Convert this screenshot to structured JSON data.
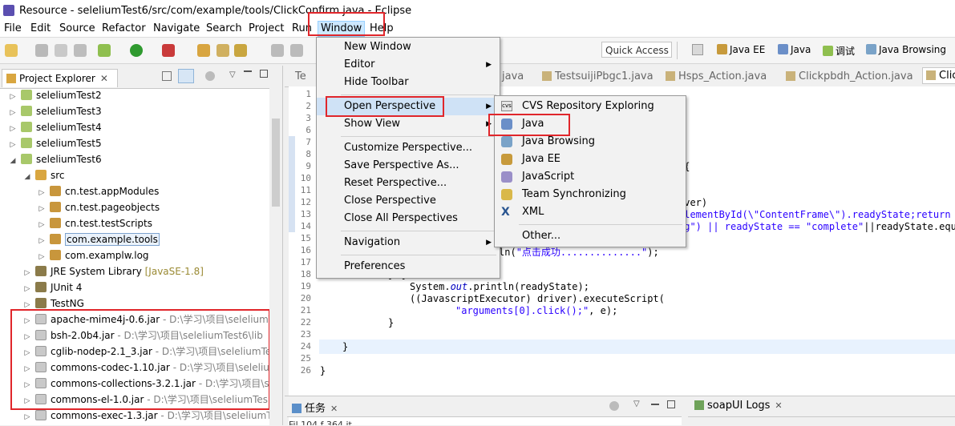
{
  "window": {
    "title": "Resource - seleliumTest6/src/com/example/tools/ClickConfirm.java - Eclipse"
  },
  "menubar": [
    "File",
    "Edit",
    "Source",
    "Refactor",
    "Navigate",
    "Search",
    "Project",
    "Run",
    "Window",
    "Help"
  ],
  "toolbar": {
    "quick_access_placeholder": "Quick Access",
    "perspectives": [
      "Java EE",
      "Java",
      "调试",
      "Java Browsing"
    ]
  },
  "explorer": {
    "tab_label": "Project Explorer",
    "items": [
      {
        "label": "seleliumTest2",
        "path": ""
      },
      {
        "label": "seleliumTest3",
        "path": ""
      },
      {
        "label": "seleliumTest4",
        "path": ""
      },
      {
        "label": "seleliumTest5",
        "path": ""
      },
      {
        "label": "seleliumTest6",
        "path": ""
      },
      {
        "label": "src",
        "path": ""
      },
      {
        "label": "cn.test.appModules",
        "path": ""
      },
      {
        "label": "cn.test.pageobjects",
        "path": ""
      },
      {
        "label": "cn.test.testScripts",
        "path": ""
      },
      {
        "label": "com.example.tools",
        "path": ""
      },
      {
        "label": "com.examplw.log",
        "path": ""
      },
      {
        "label": "JRE System Library",
        "path": "[JavaSE-1.8]"
      },
      {
        "label": "JUnit 4",
        "path": ""
      },
      {
        "label": "TestNG",
        "path": ""
      },
      {
        "label": "apache-mime4j-0.6.jar",
        "path": "- D:\\学习\\项目\\seleliumT"
      },
      {
        "label": "bsh-2.0b4.jar",
        "path": "- D:\\学习\\项目\\seleliumTest6\\lib"
      },
      {
        "label": "cglib-nodep-2.1_3.jar",
        "path": "- D:\\学习\\项目\\seleliumTe"
      },
      {
        "label": "commons-codec-1.10.jar",
        "path": "- D:\\学习\\项目\\seleliu"
      },
      {
        "label": "commons-collections-3.2.1.jar",
        "path": "- D:\\学习\\项目\\s"
      },
      {
        "label": "commons-el-1.0.jar",
        "path": "- D:\\学习\\项目\\seleliumTes"
      },
      {
        "label": "commons-exec-1.3.jar",
        "path": "- D:\\学习\\项目\\seleliumT"
      }
    ]
  },
  "editor": {
    "tabs": [
      "Te",
      "java",
      "TestsuijiPbgc1.java",
      "Hsps_Action.java",
      "Clickpbdh_Action.java",
      "Clic"
    ],
    "line_numbers": [
      "1",
      "2",
      "3",
      "6",
      "7",
      "8",
      "9",
      "10",
      "11",
      "12",
      "13",
      "14",
      "15",
      "16",
      "17",
      "18",
      "19",
      "20",
      "21",
      "22",
      "23",
      "24",
      "25",
      "26"
    ],
    "code": {
      "l9": "){",
      "l12": "iver)",
      "l13a": "ElementById(\\\"ContentFrame\\\").readyState;return",
      "l14a": "ng\") || readyState == ",
      "l14b": "\"complete\"",
      "l14c": "||readyState.equ",
      "l16a": "ln(",
      "l16b": "\"点击成功..............\"",
      "l16c": ");",
      "l18": "} {",
      "l19a": "System.",
      "l19b": "out",
      "l19c": ".println(readyState);",
      "l20": "((JavascriptExecutor) driver).executeScript(",
      "l21a": "\"arguments[0].click();\"",
      "l21b": ", e);",
      "l22": "}",
      "l24": "}",
      "l26": "}"
    }
  },
  "window_menu": [
    {
      "label": "New Window",
      "submenu": false
    },
    {
      "label": "Editor",
      "submenu": true
    },
    {
      "label": "Hide Toolbar",
      "submenu": false
    },
    {
      "label": "Open Perspective",
      "submenu": true
    },
    {
      "label": "Show View",
      "submenu": true
    },
    {
      "label": "Customize Perspective...",
      "submenu": false
    },
    {
      "label": "Save Perspective As...",
      "submenu": false
    },
    {
      "label": "Reset Perspective...",
      "submenu": false
    },
    {
      "label": "Close Perspective",
      "submenu": false
    },
    {
      "label": "Close All Perspectives",
      "submenu": false
    },
    {
      "label": "Navigation",
      "submenu": true
    },
    {
      "label": "Preferences",
      "submenu": false
    }
  ],
  "perspective_submenu": [
    {
      "label": "CVS Repository Exploring",
      "icon": "cvs-icon"
    },
    {
      "label": "Java",
      "icon": "java-perspective-icon"
    },
    {
      "label": "Java Browsing",
      "icon": "java-browsing-icon"
    },
    {
      "label": "Java EE",
      "icon": "java-ee-icon"
    },
    {
      "label": "JavaScript",
      "icon": "javascript-icon"
    },
    {
      "label": "Team Synchronizing",
      "icon": "team-sync-icon"
    },
    {
      "label": "XML",
      "icon": "xml-icon"
    },
    {
      "label": "Other...",
      "icon": ""
    }
  ],
  "bottom": {
    "tasks_tab": "任务",
    "soapui_tab": "soapUI Logs",
    "status_text": "Fil          104  f 364 it"
  },
  "colors": {
    "highlight_red": "#e0262b",
    "menu_hover": "#cfe2f6",
    "string": "#2a00ff",
    "keyword": "#7f0055"
  }
}
